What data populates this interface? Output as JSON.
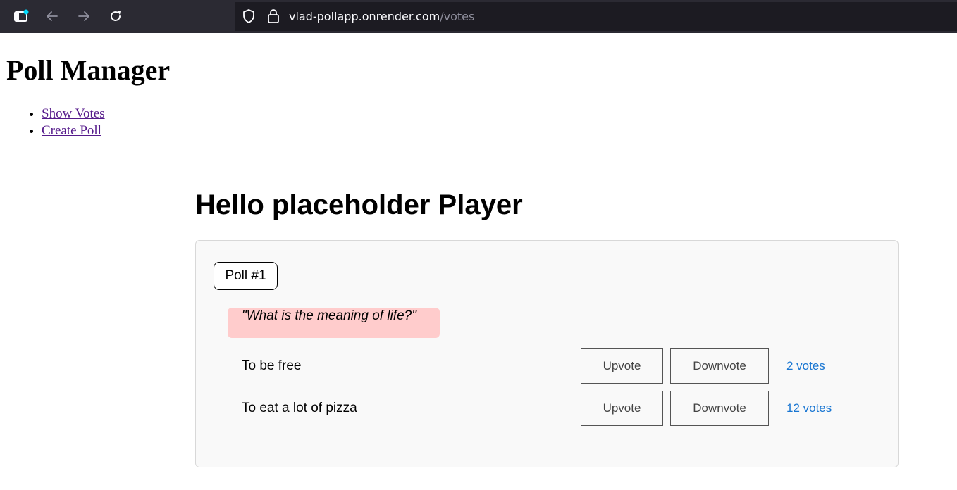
{
  "browser": {
    "url_host": "vlad-pollapp.onrender.com",
    "url_path": "/votes"
  },
  "app": {
    "title": "Poll Manager",
    "nav": [
      {
        "label": "Show Votes"
      },
      {
        "label": "Create Poll"
      }
    ]
  },
  "main": {
    "greeting": "Hello placeholder Player",
    "poll": {
      "badge": "Poll #1",
      "question": "\"What is the meaning of life?\"",
      "upvote_label": "Upvote",
      "downvote_label": "Downvote",
      "options": [
        {
          "text": "To be free",
          "votes": "2 votes"
        },
        {
          "text": "To eat a lot of pizza",
          "votes": "12 votes"
        }
      ]
    }
  },
  "colors": {
    "chrome_bg": "#2b2a33",
    "url_bar_bg": "#1c1b22",
    "visited_link": "#551a8b",
    "question_bg": "#ffcccc",
    "vote_count": "#1976d2",
    "card_bg": "#f9f9f9"
  }
}
